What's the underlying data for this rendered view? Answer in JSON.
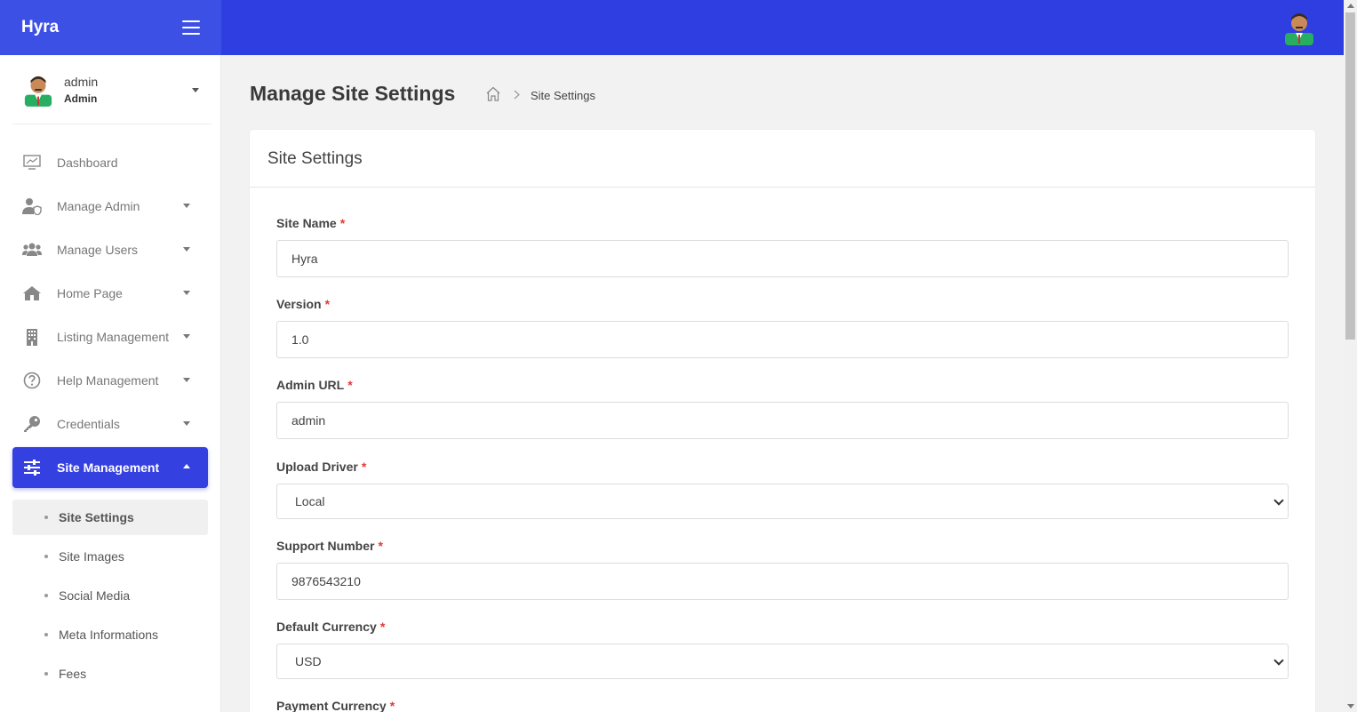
{
  "brand": {
    "name": "Hyra"
  },
  "user": {
    "name": "admin",
    "role": "Admin"
  },
  "sidebar": {
    "items": [
      {
        "label": "Dashboard",
        "icon": "dashboard-icon"
      },
      {
        "label": "Manage Admin",
        "icon": "user-shield-icon"
      },
      {
        "label": "Manage Users",
        "icon": "users-icon"
      },
      {
        "label": "Home Page",
        "icon": "home-icon"
      },
      {
        "label": "Listing Management",
        "icon": "building-icon"
      },
      {
        "label": "Help Management",
        "icon": "question-circle-icon"
      },
      {
        "label": "Credentials",
        "icon": "key-icon"
      },
      {
        "label": "Site Management",
        "icon": "sliders-icon"
      }
    ],
    "subitems": [
      {
        "label": "Site Settings"
      },
      {
        "label": "Site Images"
      },
      {
        "label": "Social Media"
      },
      {
        "label": "Meta Informations"
      },
      {
        "label": "Fees"
      }
    ]
  },
  "page": {
    "title": "Manage Site Settings",
    "breadcrumb": {
      "home_icon": "home-outline-icon",
      "current": "Site Settings"
    }
  },
  "card": {
    "title": "Site Settings"
  },
  "form": {
    "required_marker": "*",
    "site_name": {
      "label": "Site Name",
      "value": "Hyra"
    },
    "version": {
      "label": "Version",
      "value": "1.0"
    },
    "admin_url": {
      "label": "Admin URL",
      "value": "admin"
    },
    "upload_driver": {
      "label": "Upload Driver",
      "value": "Local"
    },
    "support_number": {
      "label": "Support Number",
      "value": "9876543210"
    },
    "default_currency": {
      "label": "Default Currency",
      "value": "USD"
    },
    "payment_currency": {
      "label": "Payment Currency"
    }
  },
  "colors": {
    "primary": "#3440e0",
    "topbar": "#2e3ee0",
    "brand_bg": "#3d50e6",
    "required": "#e53935"
  }
}
